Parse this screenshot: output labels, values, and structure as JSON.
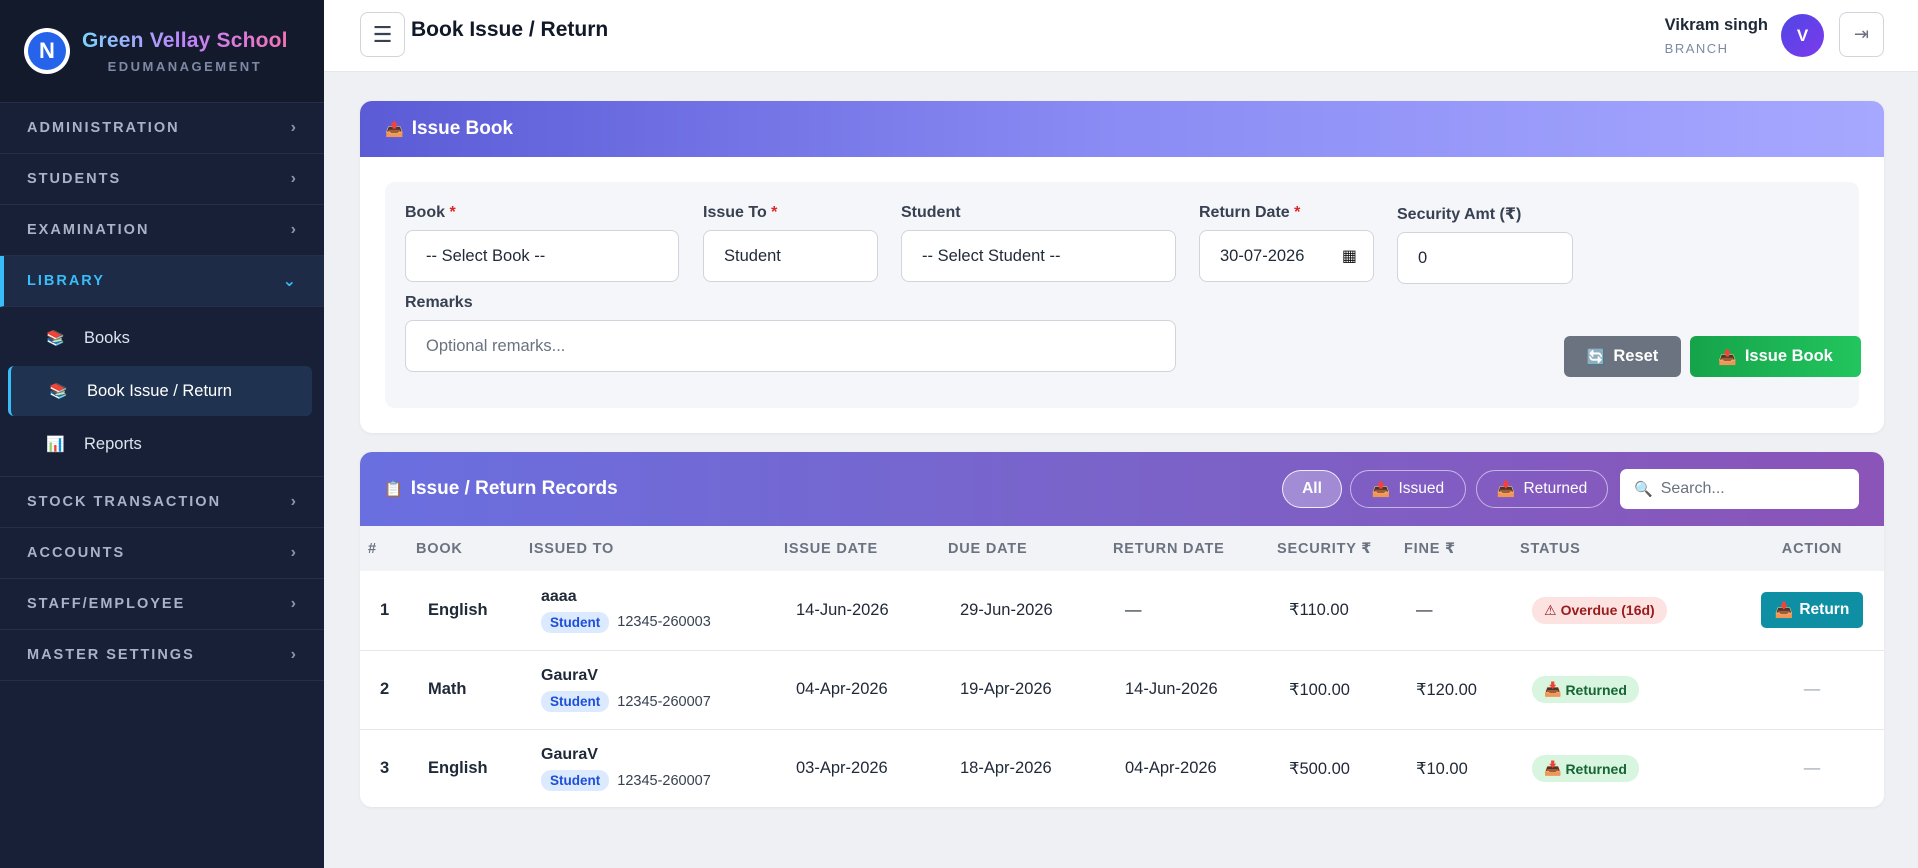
{
  "brand": {
    "name": "Green Vellay School",
    "sub": "EDUMANAGEMENT",
    "logo_letter": "N"
  },
  "sidebar": {
    "sections": [
      {
        "label": "ADMINISTRATION"
      },
      {
        "label": "STUDENTS"
      },
      {
        "label": "EXAMINATION"
      },
      {
        "label": "LIBRARY"
      },
      {
        "label": "STOCK TRANSACTION"
      },
      {
        "label": "ACCOUNTS"
      },
      {
        "label": "STAFF/EMPLOYEE"
      },
      {
        "label": "MASTER SETTINGS"
      }
    ],
    "library_items": [
      {
        "label": "Books",
        "icon": "books-icon"
      },
      {
        "label": "Book Issue / Return",
        "icon": "books-icon"
      },
      {
        "label": "Reports",
        "icon": "bar-chart-icon"
      }
    ]
  },
  "topbar": {
    "title": "Book Issue / Return",
    "user_name": "Vikram singh",
    "user_role": "BRANCH",
    "avatar_letter": "V"
  },
  "issue_form": {
    "title": "Issue Book",
    "book_label": "Book",
    "book_value": "-- Select Book --",
    "issue_to_label": "Issue To",
    "issue_to_value": "Student",
    "student_label": "Student",
    "student_value": "-- Select Student --",
    "return_date_label": "Return Date",
    "return_date_value": "30-07-2026",
    "security_label": "Security Amt (₹)",
    "security_value": "0",
    "remarks_label": "Remarks",
    "remarks_placeholder": "Optional remarks...",
    "required_mark": "*",
    "reset_label": "Reset",
    "issue_label": "Issue Book"
  },
  "records": {
    "title": "Issue / Return Records",
    "filters": {
      "all": "All",
      "issued": "Issued",
      "returned": "Returned"
    },
    "search_placeholder": "Search...",
    "columns": [
      "#",
      "BOOK",
      "ISSUED TO",
      "ISSUE DATE",
      "DUE DATE",
      "RETURN DATE",
      "SECURITY ₹",
      "FINE ₹",
      "STATUS",
      "ACTION"
    ],
    "rows": [
      {
        "idx": "1",
        "book": "English",
        "name": "aaaa",
        "type": "Student",
        "adm": "12345-260003",
        "issue": "14-Jun-2026",
        "due": "29-Jun-2026",
        "ret": "—",
        "security": "₹110.00",
        "fine": "—",
        "status": "Overdue (16d)",
        "action": "Return"
      },
      {
        "idx": "2",
        "book": "Math",
        "name": "GauraV",
        "type": "Student",
        "adm": "12345-260007",
        "issue": "04-Apr-2026",
        "due": "19-Apr-2026",
        "ret": "14-Jun-2026",
        "security": "₹100.00",
        "fine": "₹120.00",
        "status": "Returned",
        "action": "—"
      },
      {
        "idx": "3",
        "book": "English",
        "name": "GauraV",
        "type": "Student",
        "adm": "12345-260007",
        "issue": "03-Apr-2026",
        "due": "18-Apr-2026",
        "ret": "04-Apr-2026",
        "security": "₹500.00",
        "fine": "₹10.00",
        "status": "Returned",
        "action": "—"
      }
    ]
  },
  "colors": {
    "sidebar_bg": "#172036",
    "accent": "#38bdf8",
    "issue_green": "#16a34a",
    "return_teal": "#0e8fa3",
    "overdue_bg": "#fde2e2",
    "returned_bg": "#d7f5df"
  }
}
